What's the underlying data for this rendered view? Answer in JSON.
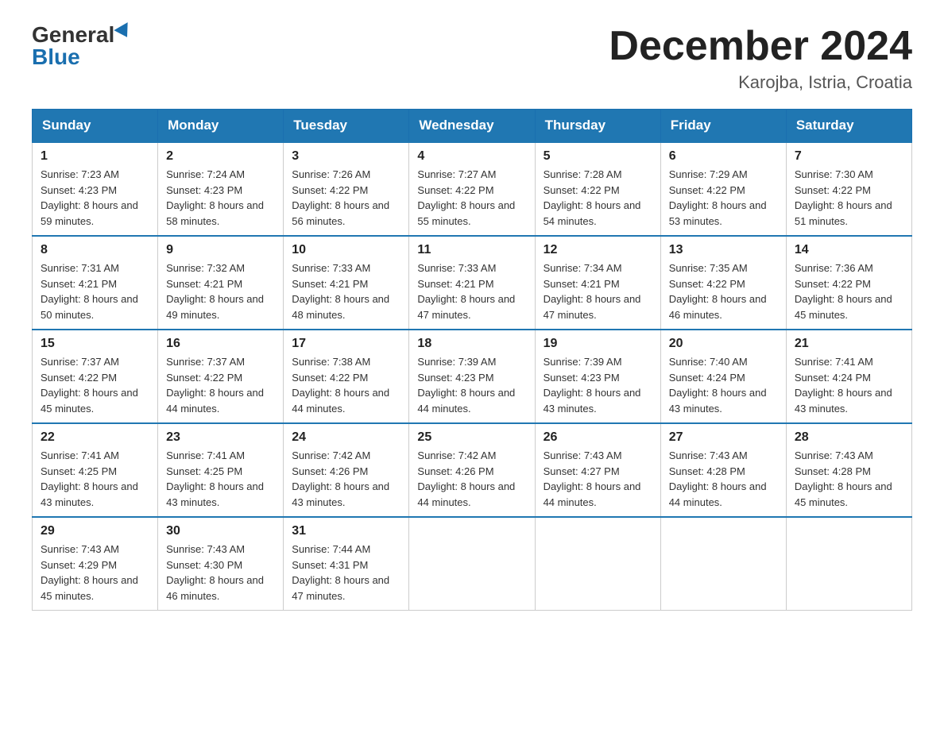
{
  "header": {
    "logo_general": "General",
    "logo_blue": "Blue",
    "month_title": "December 2024",
    "location": "Karojba, Istria, Croatia"
  },
  "weekdays": [
    "Sunday",
    "Monday",
    "Tuesday",
    "Wednesday",
    "Thursday",
    "Friday",
    "Saturday"
  ],
  "weeks": [
    [
      {
        "day": "1",
        "sunrise": "7:23 AM",
        "sunset": "4:23 PM",
        "daylight": "8 hours and 59 minutes."
      },
      {
        "day": "2",
        "sunrise": "7:24 AM",
        "sunset": "4:23 PM",
        "daylight": "8 hours and 58 minutes."
      },
      {
        "day": "3",
        "sunrise": "7:26 AM",
        "sunset": "4:22 PM",
        "daylight": "8 hours and 56 minutes."
      },
      {
        "day": "4",
        "sunrise": "7:27 AM",
        "sunset": "4:22 PM",
        "daylight": "8 hours and 55 minutes."
      },
      {
        "day": "5",
        "sunrise": "7:28 AM",
        "sunset": "4:22 PM",
        "daylight": "8 hours and 54 minutes."
      },
      {
        "day": "6",
        "sunrise": "7:29 AM",
        "sunset": "4:22 PM",
        "daylight": "8 hours and 53 minutes."
      },
      {
        "day": "7",
        "sunrise": "7:30 AM",
        "sunset": "4:22 PM",
        "daylight": "8 hours and 51 minutes."
      }
    ],
    [
      {
        "day": "8",
        "sunrise": "7:31 AM",
        "sunset": "4:21 PM",
        "daylight": "8 hours and 50 minutes."
      },
      {
        "day": "9",
        "sunrise": "7:32 AM",
        "sunset": "4:21 PM",
        "daylight": "8 hours and 49 minutes."
      },
      {
        "day": "10",
        "sunrise": "7:33 AM",
        "sunset": "4:21 PM",
        "daylight": "8 hours and 48 minutes."
      },
      {
        "day": "11",
        "sunrise": "7:33 AM",
        "sunset": "4:21 PM",
        "daylight": "8 hours and 47 minutes."
      },
      {
        "day": "12",
        "sunrise": "7:34 AM",
        "sunset": "4:21 PM",
        "daylight": "8 hours and 47 minutes."
      },
      {
        "day": "13",
        "sunrise": "7:35 AM",
        "sunset": "4:22 PM",
        "daylight": "8 hours and 46 minutes."
      },
      {
        "day": "14",
        "sunrise": "7:36 AM",
        "sunset": "4:22 PM",
        "daylight": "8 hours and 45 minutes."
      }
    ],
    [
      {
        "day": "15",
        "sunrise": "7:37 AM",
        "sunset": "4:22 PM",
        "daylight": "8 hours and 45 minutes."
      },
      {
        "day": "16",
        "sunrise": "7:37 AM",
        "sunset": "4:22 PM",
        "daylight": "8 hours and 44 minutes."
      },
      {
        "day": "17",
        "sunrise": "7:38 AM",
        "sunset": "4:22 PM",
        "daylight": "8 hours and 44 minutes."
      },
      {
        "day": "18",
        "sunrise": "7:39 AM",
        "sunset": "4:23 PM",
        "daylight": "8 hours and 44 minutes."
      },
      {
        "day": "19",
        "sunrise": "7:39 AM",
        "sunset": "4:23 PM",
        "daylight": "8 hours and 43 minutes."
      },
      {
        "day": "20",
        "sunrise": "7:40 AM",
        "sunset": "4:24 PM",
        "daylight": "8 hours and 43 minutes."
      },
      {
        "day": "21",
        "sunrise": "7:41 AM",
        "sunset": "4:24 PM",
        "daylight": "8 hours and 43 minutes."
      }
    ],
    [
      {
        "day": "22",
        "sunrise": "7:41 AM",
        "sunset": "4:25 PM",
        "daylight": "8 hours and 43 minutes."
      },
      {
        "day": "23",
        "sunrise": "7:41 AM",
        "sunset": "4:25 PM",
        "daylight": "8 hours and 43 minutes."
      },
      {
        "day": "24",
        "sunrise": "7:42 AM",
        "sunset": "4:26 PM",
        "daylight": "8 hours and 43 minutes."
      },
      {
        "day": "25",
        "sunrise": "7:42 AM",
        "sunset": "4:26 PM",
        "daylight": "8 hours and 44 minutes."
      },
      {
        "day": "26",
        "sunrise": "7:43 AM",
        "sunset": "4:27 PM",
        "daylight": "8 hours and 44 minutes."
      },
      {
        "day": "27",
        "sunrise": "7:43 AM",
        "sunset": "4:28 PM",
        "daylight": "8 hours and 44 minutes."
      },
      {
        "day": "28",
        "sunrise": "7:43 AM",
        "sunset": "4:28 PM",
        "daylight": "8 hours and 45 minutes."
      }
    ],
    [
      {
        "day": "29",
        "sunrise": "7:43 AM",
        "sunset": "4:29 PM",
        "daylight": "8 hours and 45 minutes."
      },
      {
        "day": "30",
        "sunrise": "7:43 AM",
        "sunset": "4:30 PM",
        "daylight": "8 hours and 46 minutes."
      },
      {
        "day": "31",
        "sunrise": "7:44 AM",
        "sunset": "4:31 PM",
        "daylight": "8 hours and 47 minutes."
      },
      null,
      null,
      null,
      null
    ]
  ],
  "labels": {
    "sunrise": "Sunrise:",
    "sunset": "Sunset:",
    "daylight": "Daylight:"
  }
}
